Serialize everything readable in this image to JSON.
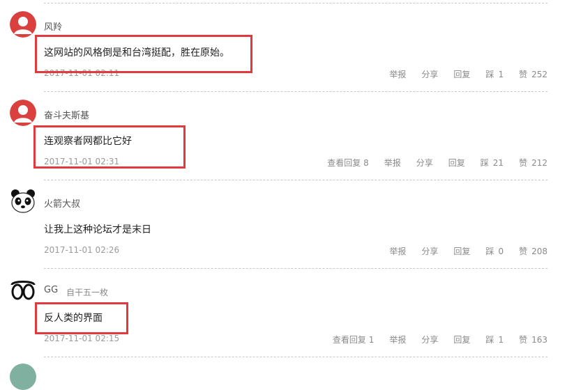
{
  "comments": [
    {
      "username": "风羚",
      "tagline": "",
      "content": "这网站的风格倒是和台湾挺配，胜在原始。",
      "time": "2017-11-01 02:11",
      "view_replies": "",
      "report": "举报",
      "share": "分享",
      "reply": "回复",
      "dislike_label": "踩",
      "dislikes": "1",
      "like_label": "赞",
      "likes": "252"
    },
    {
      "username": "奋斗夫斯基",
      "tagline": "",
      "content": "连观察者网都比它好",
      "time": "2017-11-01 02:31",
      "view_replies": "查看回复 8",
      "report": "举报",
      "share": "分享",
      "reply": "回复",
      "dislike_label": "踩",
      "dislikes": "21",
      "like_label": "赞",
      "likes": "212"
    },
    {
      "username": "火箭大叔",
      "tagline": "",
      "content": "让我上这种论坛才是末日",
      "time": "2017-11-01 02:26",
      "view_replies": "",
      "report": "举报",
      "share": "分享",
      "reply": "回复",
      "dislike_label": "踩",
      "dislikes": "0",
      "like_label": "赞",
      "likes": "208"
    },
    {
      "username": "GG",
      "tagline": "自干五一枚",
      "content": "反人类的界面",
      "time": "2017-11-01 02:15",
      "view_replies": "查看回复 1",
      "report": "举报",
      "share": "分享",
      "reply": "回复",
      "dislike_label": "踩",
      "dislikes": "1",
      "like_label": "赞",
      "likes": "163"
    }
  ],
  "colors": {
    "highlight": "#e0393e",
    "avatar_red": "#d9403e",
    "meta": "#9a9a9a"
  }
}
